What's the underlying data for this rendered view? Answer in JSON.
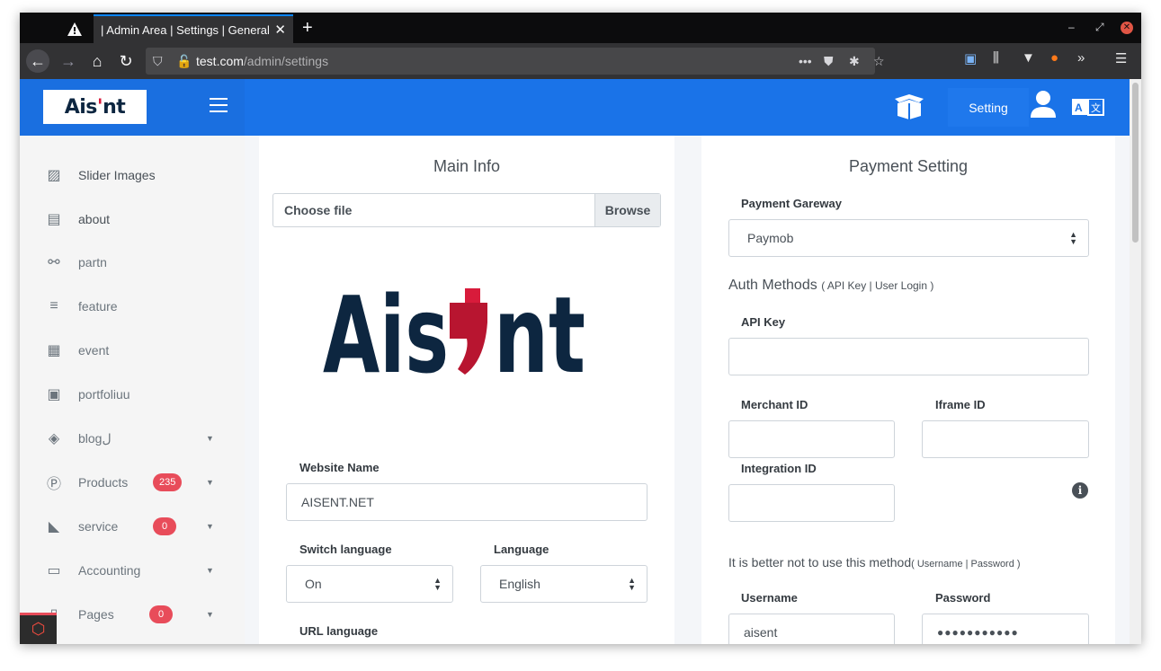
{
  "browser": {
    "tab_title": "| Admin Area | Settings | General",
    "url_host": "test.com",
    "url_path": "/admin/settings"
  },
  "header": {
    "logo": "Aisent",
    "setting_label": "Setting"
  },
  "sidebar": {
    "items": [
      {
        "label": "Slider Images",
        "icon": "images-icon"
      },
      {
        "label": "about",
        "icon": "id-card-icon"
      },
      {
        "label": "partn",
        "icon": "handshake-icon"
      },
      {
        "label": "feature",
        "icon": "align-left-icon"
      },
      {
        "label": "event",
        "icon": "calendar-icon"
      },
      {
        "label": "portfoliuu",
        "icon": "file-image-icon"
      },
      {
        "label": "blogل",
        "icon": "layers-icon"
      },
      {
        "label": "Products",
        "icon": "p-circle-icon",
        "badge": "235"
      },
      {
        "label": "service",
        "icon": "satellite-dish-icon",
        "badge": "0"
      },
      {
        "label": "Accounting",
        "icon": "money-icon"
      },
      {
        "label": "Pages",
        "icon": "file-icon",
        "badge": "0"
      }
    ]
  },
  "main_info": {
    "title": "Main Info",
    "file_choose": "Choose file",
    "file_browse": "Browse",
    "website_name_label": "Website Name",
    "website_name_value": "AISENT.NET",
    "switch_language_label": "Switch language",
    "switch_language_value": "On",
    "language_label": "Language",
    "language_value": "English",
    "url_language_label": "URL language"
  },
  "payment": {
    "title": "Payment Setting",
    "gateway_label": "Payment Gareway",
    "gateway_value": "Paymob",
    "auth_heading": "Auth Methods",
    "auth_heading_small": "( API Key | User Login )",
    "api_key_label": "API Key",
    "api_key_value": "",
    "merchant_label": "Merchant ID",
    "iframe_label": "Iframe ID",
    "integration_label": "Integration ID",
    "warning_heading": "It is better not to use this method",
    "warning_small": "( Username | Password )",
    "username_label": "Username",
    "username_value": "aisent",
    "password_label": "Password",
    "password_value": "●●●●●●●●●●●"
  }
}
